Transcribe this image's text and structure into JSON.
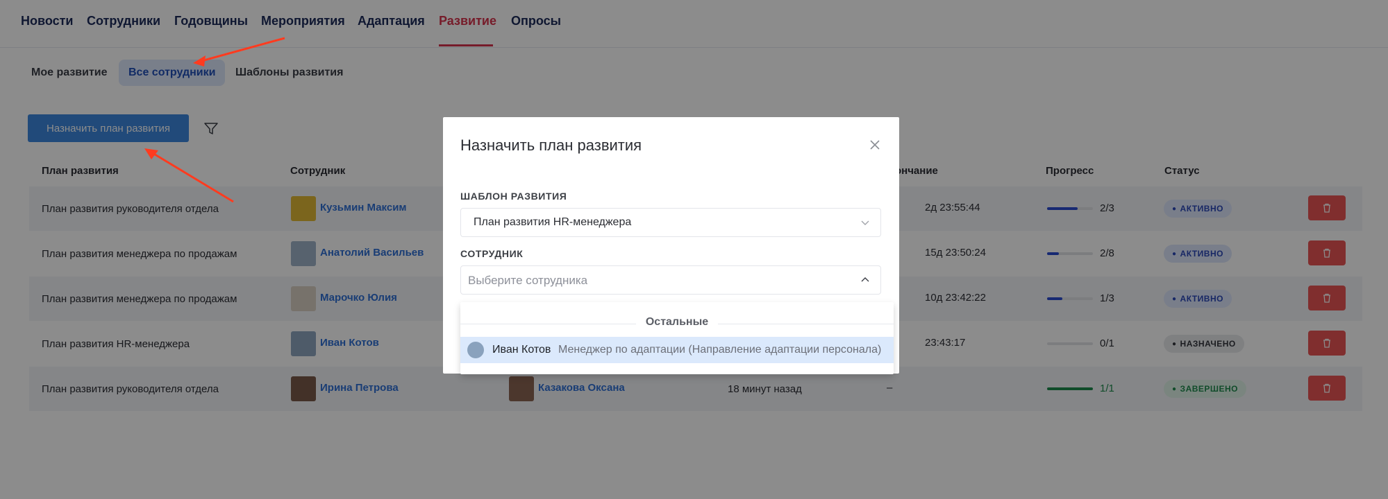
{
  "topnav": {
    "tabs": [
      {
        "label": "Новости"
      },
      {
        "label": "Сотрудники"
      },
      {
        "label": "Годовщины"
      },
      {
        "label": "Мероприятия"
      },
      {
        "label": "Адаптация"
      },
      {
        "label": "Развитие"
      },
      {
        "label": "Опросы"
      }
    ],
    "active_color": "#d8334d"
  },
  "subtabs": {
    "items": [
      {
        "label": "Мое развитие"
      },
      {
        "label": "Все сотрудники"
      },
      {
        "label": "Шаблоны развития"
      }
    ]
  },
  "toolbar": {
    "assign_label": "Назначить план развития",
    "filter_icon": "filter-icon"
  },
  "table": {
    "headers": {
      "plan": "План развития",
      "employee": "Сотрудник",
      "end": "ончание",
      "progress": "Прогресс",
      "status": "Статус"
    },
    "rows": [
      {
        "plan": "План развития руководителя отдела",
        "employee": "Кузьмин Максим",
        "time": "2д 23:55:44",
        "progress": "2/3",
        "progress_fraction": 0.667,
        "status": "АКТИВНО"
      },
      {
        "plan": "План развития менеджера по продажам",
        "employee": "Анатолий Васильев",
        "time": "15д 23:50:24",
        "progress": "2/8",
        "progress_fraction": 0.25,
        "status": "АКТИВНО"
      },
      {
        "plan": "План развития менеджера по продажам",
        "employee": "Марочко Юлия",
        "time": "10д 23:42:22",
        "progress": "1/3",
        "progress_fraction": 0.333,
        "status": "АКТИВНО"
      },
      {
        "plan": "План развития HR-менеджера",
        "employee": "Иван Котов",
        "time": "23:43:17",
        "progress": "0/1",
        "progress_fraction": 0,
        "status": "НАЗНАЧЕНО"
      },
      {
        "plan": "План развития руководителя отдела",
        "employee": "Ирина Петрова",
        "mentor": "Казакова Оксана",
        "assigned": "18 минут назад",
        "time": "–",
        "progress": "1/1",
        "progress_fraction": 1,
        "status": "ЗАВЕРШЕНО"
      }
    ]
  },
  "modal": {
    "title": "Назначить план развития",
    "template_label": "ШАБЛОН РАЗВИТИЯ",
    "template_value": "План развития HR-менеджера",
    "employee_label": "СОТРУДНИК",
    "employee_placeholder": "Выберите сотрудника",
    "dropdown": {
      "group": "Остальные",
      "option_name": "Иван Котов",
      "option_sub": "Менеджер по адаптации (Направление адаптации персонала)"
    }
  },
  "colors": {
    "primary_button": "#3d87de",
    "delete_button": "#ea5454",
    "progress_active": "#2a4bd0",
    "progress_done": "#1e8a4d",
    "link": "#2f6fd6"
  }
}
